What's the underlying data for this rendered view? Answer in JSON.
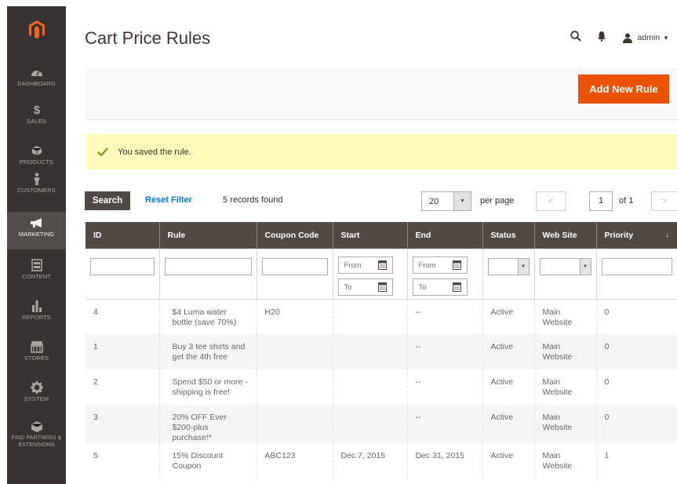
{
  "sidebar": {
    "logo": "magento-logo",
    "items": [
      {
        "label": "DASHBOARD",
        "icon": "speedometer-icon"
      },
      {
        "label": "SALES",
        "icon": "dollar-icon"
      },
      {
        "label": "PRODUCTS",
        "icon": "cube-icon"
      },
      {
        "label": "CUSTOMERS",
        "icon": "person-icon"
      },
      {
        "label": "MARKETING",
        "icon": "megaphone-icon"
      },
      {
        "label": "CONTENT",
        "icon": "layout-icon"
      },
      {
        "label": "REPORTS",
        "icon": "bar-chart-icon"
      },
      {
        "label": "STORES",
        "icon": "storefront-icon"
      },
      {
        "label": "SYSTEM",
        "icon": "gear-icon"
      },
      {
        "label": "FIND PARTNERS & EXTENSIONS",
        "icon": "box-icon"
      }
    ]
  },
  "header": {
    "title": "Cart Price Rules",
    "user": "admin"
  },
  "actions": {
    "add_new": "Add New Rule"
  },
  "message": {
    "text": "You saved the rule."
  },
  "toolbar": {
    "search": "Search",
    "reset": "Reset Filter",
    "records": "5 records found",
    "per_page_value": "20",
    "per_page_label": "per page",
    "page": "1",
    "of": "of 1"
  },
  "grid": {
    "columns": [
      "ID",
      "Rule",
      "Coupon Code",
      "Start",
      "End",
      "Status",
      "Web Site",
      "Priority"
    ],
    "filters": {
      "from_placeholder": "From",
      "to_placeholder": "To"
    },
    "rows": [
      {
        "id": "4",
        "rule": "$4 Luma water bottle (save 70%)",
        "coupon": "H20",
        "start": "",
        "end": "--",
        "status": "Active",
        "website": "Main Website",
        "priority": "0"
      },
      {
        "id": "1",
        "rule": "Buy 3 tee shirts and get the 4th free",
        "coupon": "",
        "start": "",
        "end": "--",
        "status": "Active",
        "website": "Main Website",
        "priority": "0"
      },
      {
        "id": "2",
        "rule": "Spend $50 or more - shipping is free!",
        "coupon": "",
        "start": "",
        "end": "--",
        "status": "Active",
        "website": "Main Website",
        "priority": "0"
      },
      {
        "id": "3",
        "rule": "20% OFF Ever $200-plus purchase!*",
        "coupon": "",
        "start": "",
        "end": "--",
        "status": "Active",
        "website": "Main Website",
        "priority": "0"
      },
      {
        "id": "5",
        "rule": "15% Discount Coupon",
        "coupon": "ABC123",
        "start": "Dec 7, 2015",
        "end": "Dec 31, 2015",
        "status": "Active",
        "website": "Main Website",
        "priority": "1"
      }
    ]
  },
  "colors": {
    "sidebar_bg": "#373330",
    "accent": "#eb5202",
    "grid_header": "#514943",
    "message_bg": "#fffbbb",
    "link": "#007bdb"
  }
}
